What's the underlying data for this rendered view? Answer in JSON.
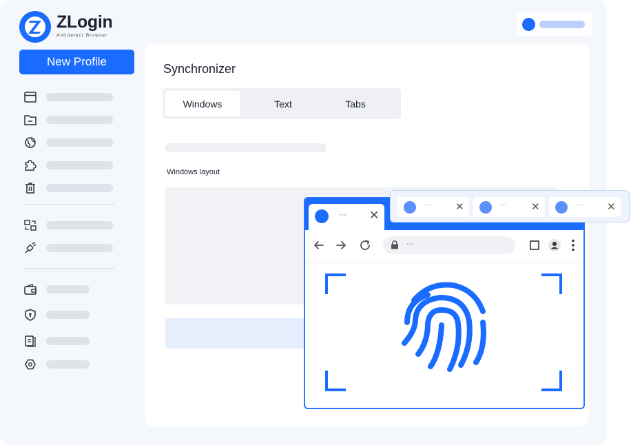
{
  "brand": {
    "name": "ZLogin",
    "tagline": "Antidetect Browser",
    "logo_letter": "Z",
    "accent": "#1a6cff"
  },
  "sidebar": {
    "new_profile_label": "New Profile",
    "items": [
      {
        "icon": "browser-window-icon"
      },
      {
        "icon": "folder-icon"
      },
      {
        "icon": "globe-icon"
      },
      {
        "icon": "puzzle-extension-icon"
      },
      {
        "icon": "trash-icon"
      },
      {
        "icon": "sync-windows-icon"
      },
      {
        "icon": "plug-icon"
      },
      {
        "icon": "wallet-icon"
      },
      {
        "icon": "shield-icon"
      },
      {
        "icon": "document-icon"
      },
      {
        "icon": "settings-icon"
      }
    ]
  },
  "main": {
    "title": "Synchronizer",
    "tabs": [
      {
        "label": "Windows",
        "active": true
      },
      {
        "label": "Text",
        "active": false
      },
      {
        "label": "Tabs",
        "active": false
      }
    ],
    "section_label": "Windows layout"
  },
  "browser": {
    "tab_label": "···",
    "url_text": "···"
  },
  "floating_tabs": [
    {
      "label": "···"
    },
    {
      "label": "···"
    },
    {
      "label": "···"
    }
  ]
}
